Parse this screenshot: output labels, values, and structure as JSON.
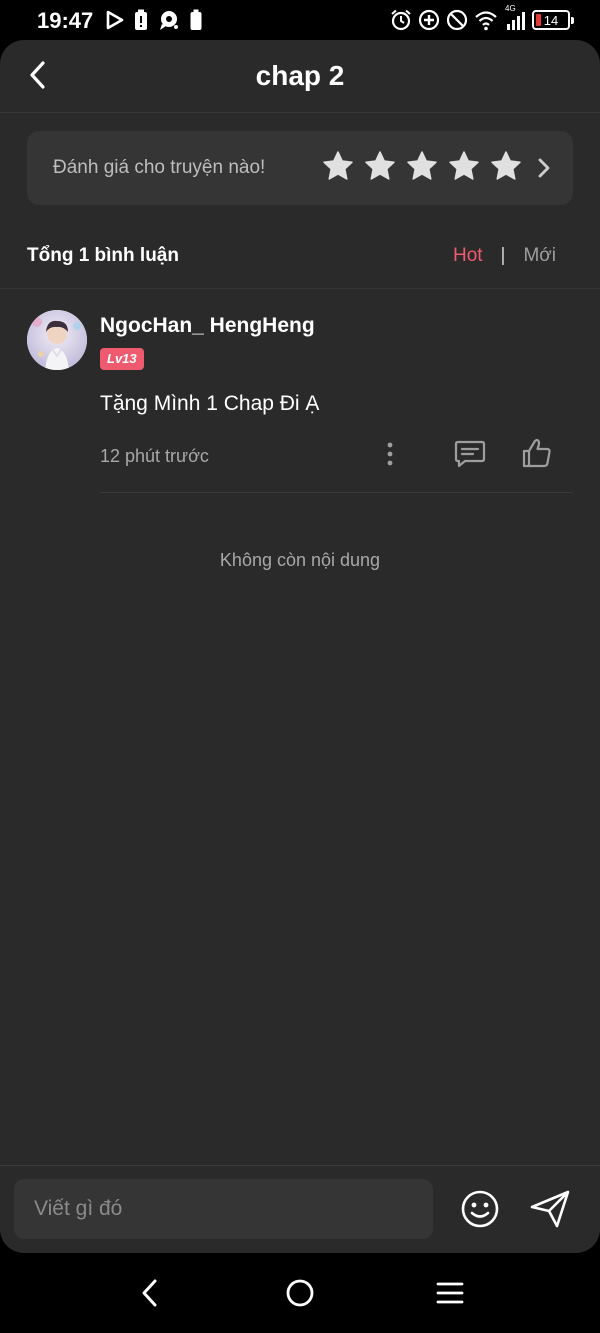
{
  "status_bar": {
    "time": "19:47",
    "network_label": "4G",
    "battery_level": "14",
    "battery_fraction": 0.14,
    "battery_color": "#e53935"
  },
  "header": {
    "title": "chap 2",
    "back_icon": "chevron-left-icon"
  },
  "rating": {
    "prompt": "Đánh giá cho truyện nào!",
    "star_count": 5,
    "star_color": "#e0e0e0"
  },
  "comments": {
    "total_label": "Tổng 1 bình luận",
    "sort_options": [
      "Hot",
      "|",
      "Mới"
    ],
    "active_sort": "Hot",
    "accent_color": "#ef5a6f",
    "items": [
      {
        "username": "NgocHan_ HengHeng",
        "level": "Lv13",
        "text": "Tặng Mình 1 Chap Đi Ạ",
        "time": "12 phút trước"
      }
    ],
    "end_note": "Không còn nội dung"
  },
  "composer": {
    "placeholder": "Viết gì đó"
  }
}
